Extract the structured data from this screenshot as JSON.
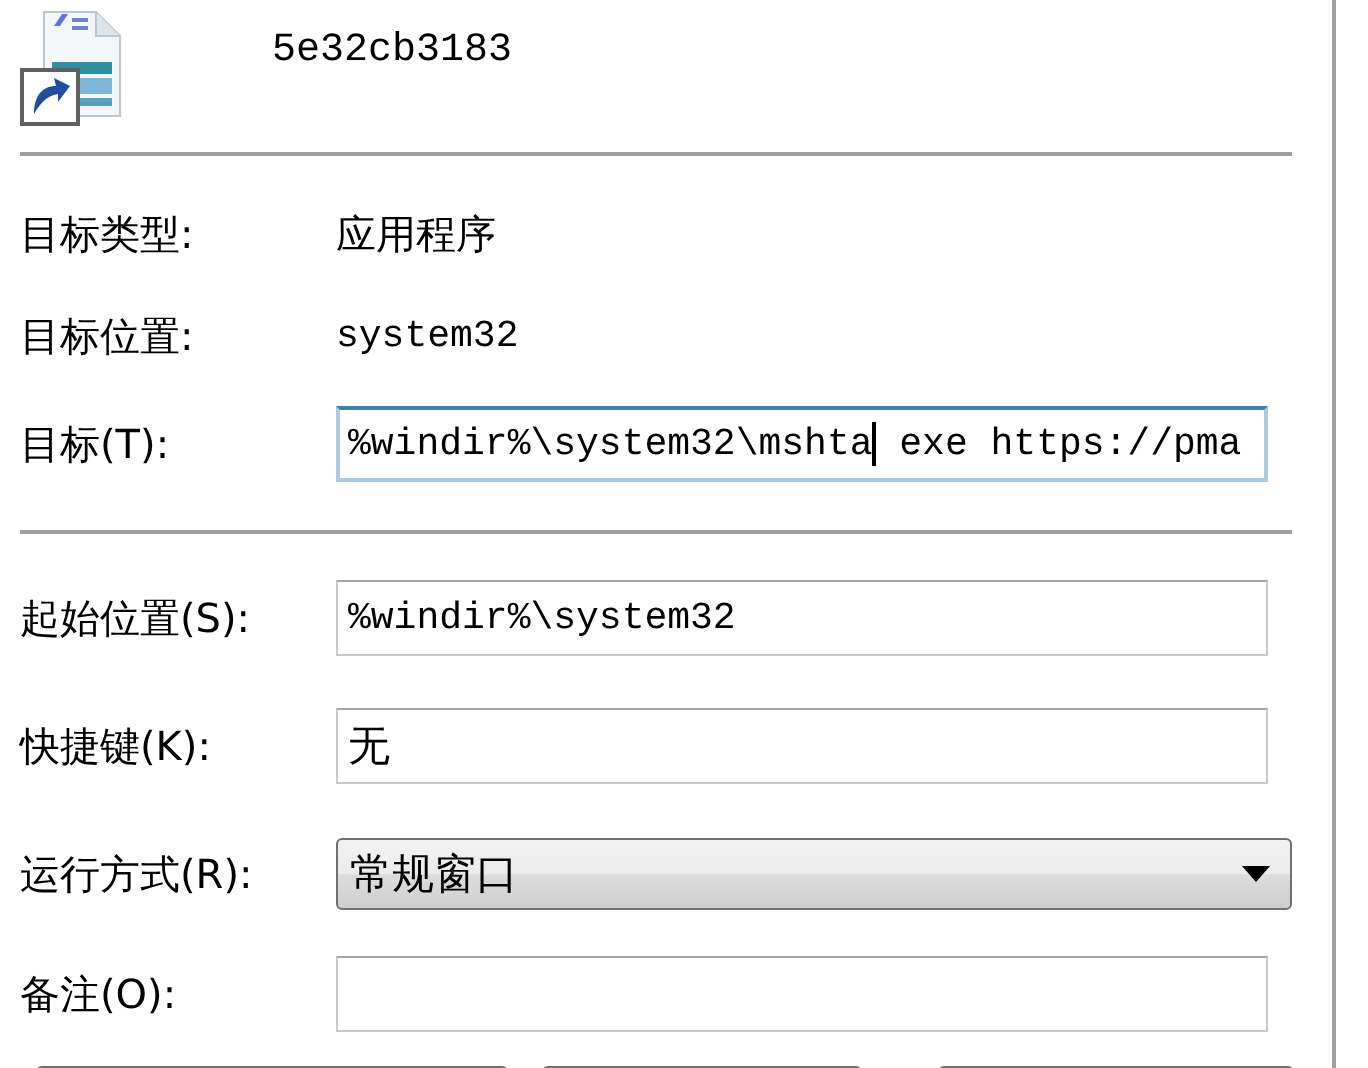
{
  "header": {
    "name": "5e32cb3183"
  },
  "sections": [
    {
      "rows": [
        {
          "kind": "text",
          "label": "目标类型:",
          "value": "应用程序"
        },
        {
          "kind": "text",
          "label": "目标位置:",
          "value": "system32"
        },
        {
          "kind": "field",
          "label": "目标(T):",
          "value": "%windir%\\system32\\mshta",
          "value_after_caret": " exe https://pma",
          "focused": true
        }
      ]
    },
    {
      "rows": [
        {
          "kind": "field",
          "label": "起始位置(S):",
          "value": "%windir%\\system32",
          "focused": false
        },
        {
          "kind": "field",
          "label": "快捷键(K):",
          "value": "无",
          "focused": false
        },
        {
          "kind": "combo",
          "label": "运行方式(R):",
          "value": "常规窗口"
        },
        {
          "kind": "field",
          "label": "备注(O):",
          "focused": false
        }
      ]
    }
  ],
  "bottom_buttons": [
    {
      "kind": "button"
    },
    {
      "kind": "button"
    },
    {
      "kind": "button"
    }
  ]
}
